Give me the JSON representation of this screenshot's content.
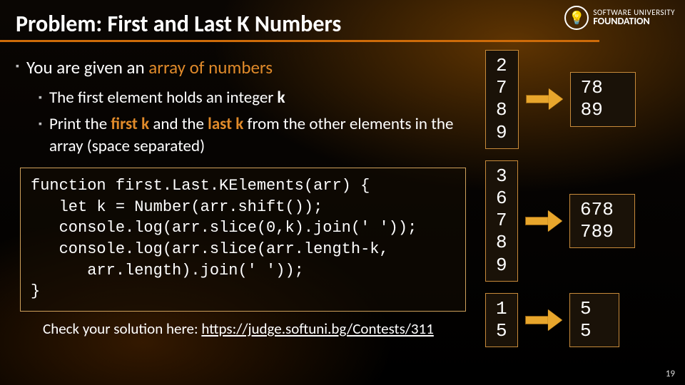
{
  "title": "Problem: First and Last K Numbers",
  "logo": {
    "top": "SOFTWARE UNIVERSITY",
    "bottom": "FOUNDATION"
  },
  "bullets": {
    "l1_pre": "You are given an ",
    "l1_hl": "array of numbers",
    "l2a_pre": "The first element holds an integer ",
    "l2a_k": "k",
    "l2b_pre": "Print the ",
    "l2b_h1": "first k",
    "l2b_mid": " and the ",
    "l2b_h2": "last k",
    "l2b_post": " from the other elements in the array (space separated)"
  },
  "code": "function first.Last.KElements(arr) {\n   let k = Number(arr.shift());\n   console.log(arr.slice(0,k).join(' '));\n   console.log(arr.slice(arr.length-k,\n      arr.length).join(' '));\n}",
  "check": {
    "label": "Check your solution here: ",
    "link": "https://judge.softuni.bg/Contests/311"
  },
  "examples": [
    {
      "in": "2\n7\n8\n9",
      "out": "78\n89"
    },
    {
      "in": "3\n6\n7\n8\n9",
      "out": "678\n789"
    },
    {
      "in": "1\n5",
      "out": "5\n5"
    }
  ],
  "page": "19"
}
